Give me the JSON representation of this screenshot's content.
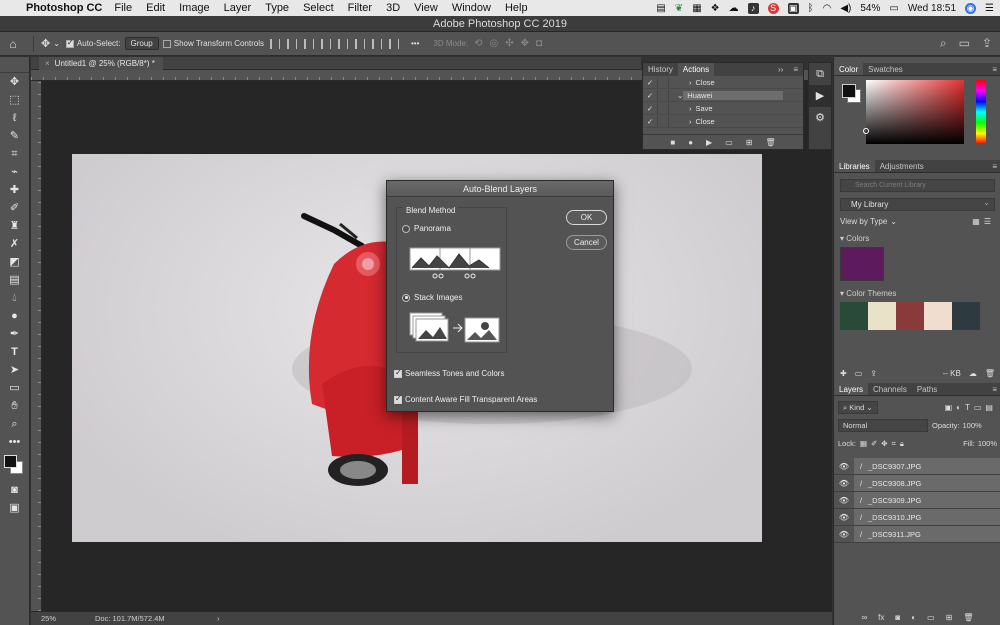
{
  "menubar": {
    "app_name": "Photoshop CC",
    "items": [
      "File",
      "Edit",
      "Image",
      "Layer",
      "Type",
      "Select",
      "Filter",
      "3D",
      "View",
      "Window",
      "Help"
    ],
    "battery": "54%",
    "clock": "Wed 18:51"
  },
  "window": {
    "title": "Adobe Photoshop CC 2019"
  },
  "options_bar": {
    "auto_select_label": "Auto-Select:",
    "auto_select_value": "Group",
    "transform_controls_label": "Show Transform Controls",
    "mode_3d_label": "3D Mode:"
  },
  "document": {
    "tab_title": "Untitled1 @ 25% (RGB/8*) *",
    "zoom": "25%",
    "doc_info": "Doc: 101.7M/572.4M"
  },
  "actions_panel": {
    "tabs": [
      "History",
      "Actions"
    ],
    "rows": [
      {
        "label": "Close",
        "indent": 2
      },
      {
        "label": "Huawei",
        "indent": 1
      },
      {
        "label": "Save",
        "indent": 2
      },
      {
        "label": "Close",
        "indent": 2
      }
    ]
  },
  "color_panel": {
    "tabs": [
      "Color",
      "Swatches"
    ]
  },
  "libraries_panel": {
    "tabs": [
      "Libraries",
      "Adjustments"
    ],
    "search_placeholder": "Search Current Library",
    "library": "My Library",
    "view_by": "View by Type",
    "colors_label": "Colors",
    "themes_label": "Color Themes",
    "color_swatch": "#5d1a5c",
    "theme_colors": [
      "#2a4a38",
      "#e9e2c8",
      "#8a3a3a",
      "#f0ddd0",
      "#2d3a40"
    ],
    "storage": "-- KB"
  },
  "layers_panel": {
    "tabs": [
      "Layers",
      "Channels",
      "Paths"
    ],
    "filter": "Kind",
    "blend_mode": "Normal",
    "opacity_label": "Opacity:",
    "opacity": "100%",
    "lock_label": "Lock:",
    "fill_label": "Fill:",
    "fill": "100%",
    "layers": [
      "_DSC9307.JPG",
      "_DSC9308.JPG",
      "_DSC9309.JPG",
      "_DSC9310.JPG",
      "_DSC9311.JPG"
    ]
  },
  "dialog": {
    "title": "Auto-Blend Layers",
    "group_label": "Blend Method",
    "options": [
      "Panorama",
      "Stack Images"
    ],
    "selected_option": "Stack Images",
    "ok_label": "OK",
    "cancel_label": "Cancel",
    "seamless_label": "Seamless Tones and Colors",
    "seamless_checked": true,
    "content_aware_label": "Content Aware Fill Transparent Areas",
    "content_aware_checked": true
  }
}
